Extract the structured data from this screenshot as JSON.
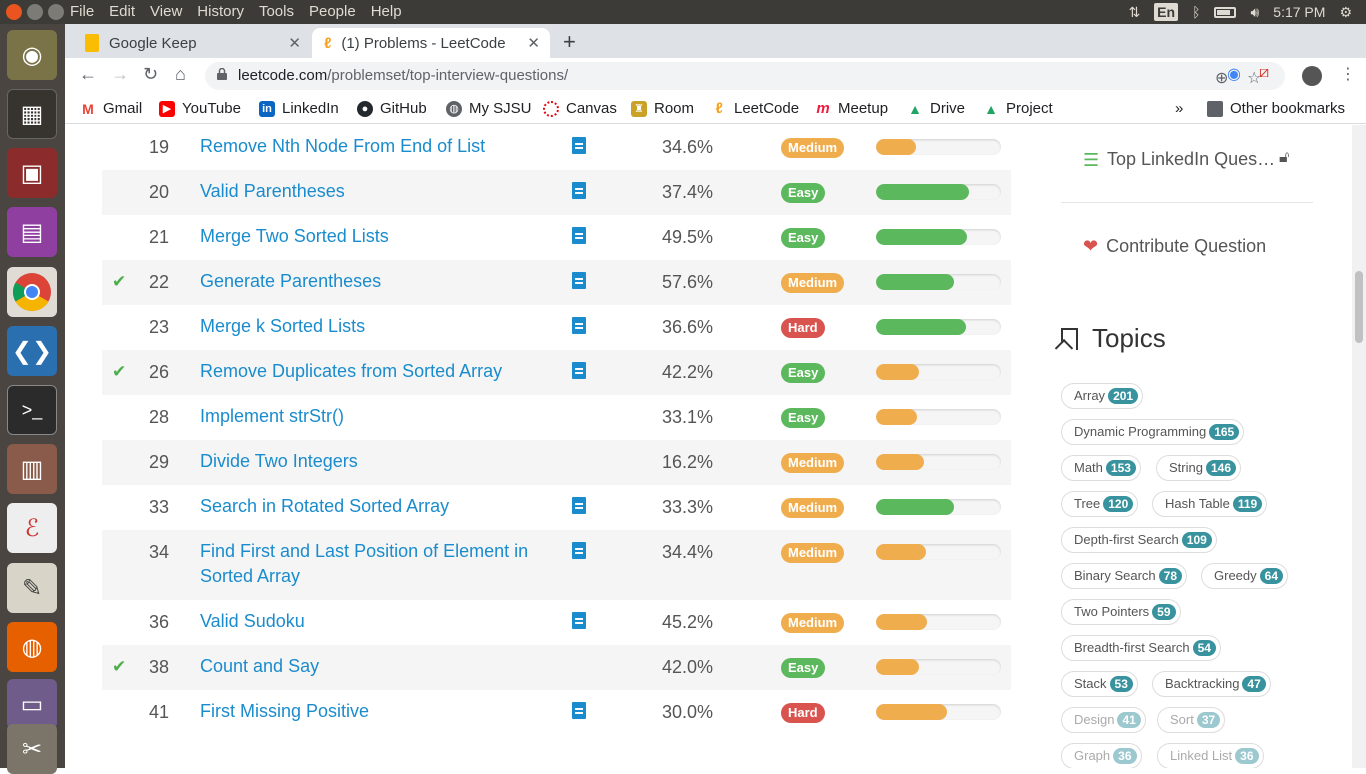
{
  "top_panel": {
    "menus": [
      "File",
      "Edit",
      "View",
      "History",
      "Tools",
      "People",
      "Help"
    ],
    "keyboard_layout": "En",
    "clock": "5:17 PM"
  },
  "launcher": {
    "items": [
      "ubuntu-dash",
      "workspace-switcher",
      "remmina",
      "files",
      "chrome",
      "vscode",
      "terminal",
      "file-cabinet",
      "document-viewer",
      "text-editor",
      "firefox",
      "screenshot",
      "trash"
    ]
  },
  "tabs": [
    {
      "title": "Google Keep",
      "active": false
    },
    {
      "title": "(1) Problems - LeetCode",
      "active": true
    }
  ],
  "omnibox": {
    "domain": "leetcode.com",
    "path": "/problemset/top-interview-questions/"
  },
  "bookmarks": [
    {
      "label": "Gmail",
      "icon": "gmail-icon",
      "color": "#ea4335"
    },
    {
      "label": "YouTube",
      "icon": "youtube-icon",
      "color": "#ff0000"
    },
    {
      "label": "LinkedIn",
      "icon": "linkedin-icon",
      "color": "#0a66c2"
    },
    {
      "label": "GitHub",
      "icon": "github-icon",
      "color": "#24292e"
    },
    {
      "label": "My SJSU",
      "icon": "globe-icon",
      "color": "#5f6368"
    },
    {
      "label": "Canvas",
      "icon": "canvas-icon",
      "color": "#e4060f"
    },
    {
      "label": "Room",
      "icon": "room-icon",
      "color": "#c9a227"
    },
    {
      "label": "LeetCode",
      "icon": "leetcode-icon",
      "color": "#f89f1b"
    },
    {
      "label": "Meetup",
      "icon": "meetup-icon",
      "color": "#ed1c40"
    },
    {
      "label": "Drive",
      "icon": "drive-icon",
      "color": "#1fa463"
    },
    {
      "label": "Project",
      "icon": "drive-icon",
      "color": "#1fa463"
    }
  ],
  "bookmarks_overflow": "»",
  "other_bookmarks": "Other bookmarks",
  "problems": [
    {
      "num": "19",
      "title": "Remove Nth Node From End of List",
      "solved": false,
      "solution": true,
      "acceptance": "34.6%",
      "difficulty": "Medium",
      "frequency": 0.32,
      "freq_color": "orange"
    },
    {
      "num": "20",
      "title": "Valid Parentheses",
      "solved": false,
      "solution": true,
      "acceptance": "37.4%",
      "difficulty": "Easy",
      "frequency": 0.74,
      "freq_color": "green"
    },
    {
      "num": "21",
      "title": "Merge Two Sorted Lists",
      "solved": false,
      "solution": true,
      "acceptance": "49.5%",
      "difficulty": "Easy",
      "frequency": 0.73,
      "freq_color": "green"
    },
    {
      "num": "22",
      "title": "Generate Parentheses",
      "solved": true,
      "solution": true,
      "acceptance": "57.6%",
      "difficulty": "Medium",
      "frequency": 0.62,
      "freq_color": "green"
    },
    {
      "num": "23",
      "title": "Merge k Sorted Lists",
      "solved": false,
      "solution": true,
      "acceptance": "36.6%",
      "difficulty": "Hard",
      "frequency": 0.72,
      "freq_color": "green"
    },
    {
      "num": "26",
      "title": "Remove Duplicates from Sorted Array",
      "solved": true,
      "solution": true,
      "acceptance": "42.2%",
      "difficulty": "Easy",
      "frequency": 0.34,
      "freq_color": "orange"
    },
    {
      "num": "28",
      "title": "Implement strStr()",
      "solved": false,
      "solution": false,
      "acceptance": "33.1%",
      "difficulty": "Easy",
      "frequency": 0.33,
      "freq_color": "orange"
    },
    {
      "num": "29",
      "title": "Divide Two Integers",
      "solved": false,
      "solution": false,
      "acceptance": "16.2%",
      "difficulty": "Medium",
      "frequency": 0.38,
      "freq_color": "orange"
    },
    {
      "num": "33",
      "title": "Search in Rotated Sorted Array",
      "solved": false,
      "solution": true,
      "acceptance": "33.3%",
      "difficulty": "Medium",
      "frequency": 0.62,
      "freq_color": "green"
    },
    {
      "num": "34",
      "title": "Find First and Last Position of Element in Sorted Array",
      "solved": false,
      "solution": true,
      "acceptance": "34.4%",
      "difficulty": "Medium",
      "frequency": 0.4,
      "freq_color": "orange"
    },
    {
      "num": "36",
      "title": "Valid Sudoku",
      "solved": false,
      "solution": true,
      "acceptance": "45.2%",
      "difficulty": "Medium",
      "frequency": 0.41,
      "freq_color": "orange"
    },
    {
      "num": "38",
      "title": "Count and Say",
      "solved": true,
      "solution": false,
      "acceptance": "42.0%",
      "difficulty": "Easy",
      "frequency": 0.34,
      "freq_color": "orange"
    },
    {
      "num": "41",
      "title": "First Missing Positive",
      "solved": false,
      "solution": true,
      "acceptance": "30.0%",
      "difficulty": "Hard",
      "frequency": 0.57,
      "freq_color": "orange"
    }
  ],
  "sidebar": {
    "top_linkedin": "Top LinkedIn Ques…",
    "contribute": "Contribute Question",
    "topics_title": "Topics",
    "topics": [
      {
        "name": "Array",
        "count": "201",
        "faded": false
      },
      {
        "name": "Dynamic Programming",
        "count": "165",
        "faded": false
      },
      {
        "name": "Math",
        "count": "153",
        "faded": false
      },
      {
        "name": "String",
        "count": "146",
        "faded": false
      },
      {
        "name": "Tree",
        "count": "120",
        "faded": false
      },
      {
        "name": "Hash Table",
        "count": "119",
        "faded": false
      },
      {
        "name": "Depth-first Search",
        "count": "109",
        "faded": false
      },
      {
        "name": "Binary Search",
        "count": "78",
        "faded": false
      },
      {
        "name": "Greedy",
        "count": "64",
        "faded": false
      },
      {
        "name": "Two Pointers",
        "count": "59",
        "faded": false
      },
      {
        "name": "Breadth-first Search",
        "count": "54",
        "faded": false
      },
      {
        "name": "Stack",
        "count": "53",
        "faded": false
      },
      {
        "name": "Backtracking",
        "count": "47",
        "faded": false
      },
      {
        "name": "Design",
        "count": "41",
        "faded": true
      },
      {
        "name": "Sort",
        "count": "37",
        "faded": true
      },
      {
        "name": "Graph",
        "count": "36",
        "faded": true
      },
      {
        "name": "Linked List",
        "count": "36",
        "faded": true
      }
    ]
  }
}
